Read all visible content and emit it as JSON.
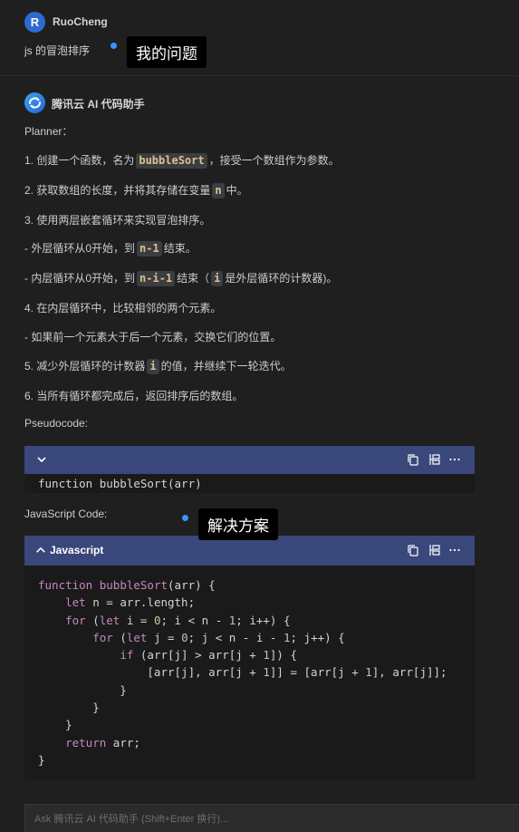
{
  "user": {
    "avatar_letter": "R",
    "name": "RuoCheng",
    "question": "js 的冒泡排序"
  },
  "annotations": {
    "question_tooltip": "我的问题",
    "solution_tooltip": "解决方案"
  },
  "assistant": {
    "name": "腾讯云 AI 代码助手",
    "planner_label": "Planner：",
    "steps": [
      {
        "pre": "1. 创建一个函数，名为",
        "code": "bubbleSort",
        "post": "，接受一个数组作为参数。"
      },
      {
        "pre": "2. 获取数组的长度，并将其存储在变量",
        "code": "n",
        "post": "中。"
      },
      {
        "pre": "3. 使用两层嵌套循环来实现冒泡排序。",
        "code": "",
        "post": ""
      },
      {
        "pre": "- 外层循环从0开始，到",
        "code": "n-1",
        "post": "结束。"
      },
      {
        "pre": "- 内层循环从0开始，到",
        "code": "n-i-1",
        "post": "结束（",
        "code2": "i",
        "post2": "是外层循环的计数器)。"
      },
      {
        "pre": "4. 在内层循环中，比较相邻的两个元素。",
        "code": "",
        "post": ""
      },
      {
        "pre": "- 如果前一个元素大于后一个元素，交换它们的位置。",
        "code": "",
        "post": ""
      },
      {
        "pre": "5. 减少外层循环的计数器",
        "code": "i",
        "post": "的值，并继续下一轮迭代。"
      },
      {
        "pre": "6. 当所有循环都完成后，返回排序后的数组。",
        "code": "",
        "post": ""
      }
    ],
    "pseudocode_label": "Pseudocode:",
    "pseudocode_line": "function bubbleSort(arr)",
    "js_label": "JavaScript Code:",
    "js_lang": "Javascript",
    "js_code": [
      "function bubbleSort(arr) {",
      "    let n = arr.length;",
      "    for (let i = 0; i < n - 1; i++) {",
      "        for (let j = 0; j < n - i - 1; j++) {",
      "            if (arr[j] > arr[j + 1]) {",
      "                [arr[j], arr[j + 1]] = [arr[j + 1], arr[j]];",
      "            }",
      "        }",
      "    }",
      "    return arr;",
      "}"
    ]
  },
  "input": {
    "placeholder": "Ask 腾讯云 AI 代码助手 (Shift+Enter 换行)..."
  },
  "colors": {
    "code_header": "#39477a",
    "accent_dot": "#3794ff",
    "inline_code": "#e2c08d"
  },
  "icons": [
    "chevron-down-icon",
    "chevron-up-icon",
    "copy-icon",
    "insert-icon",
    "more-icon"
  ]
}
